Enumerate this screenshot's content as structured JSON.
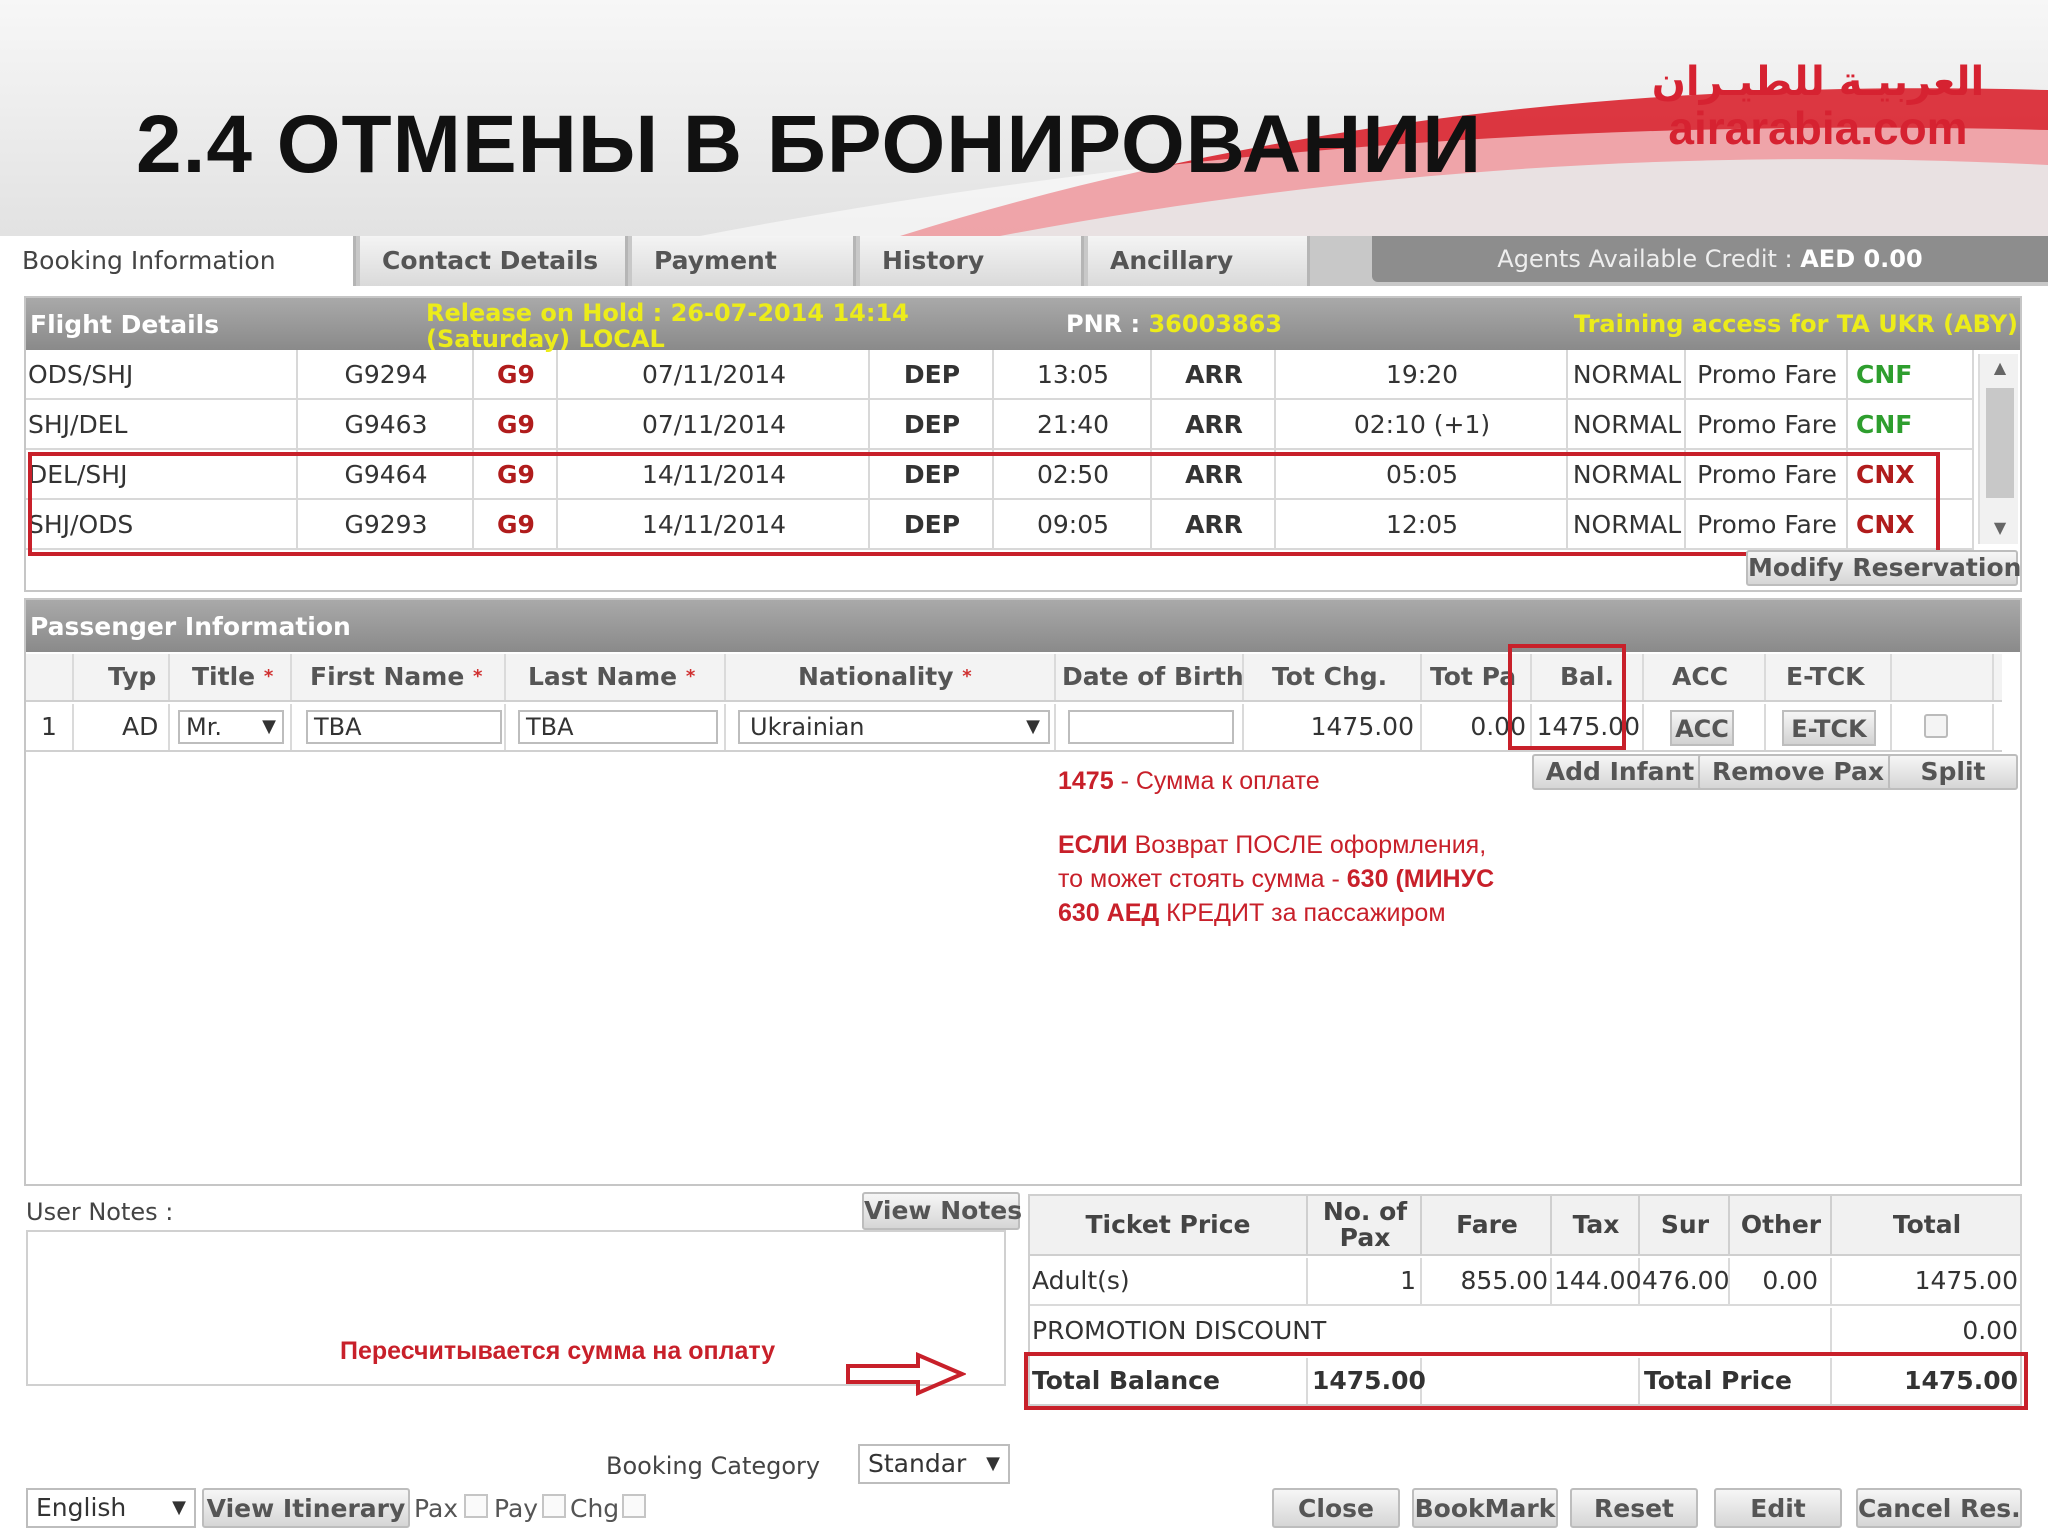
{
  "slide": {
    "title": "2.4 ОТМЕНЫ В БРОНИРОВАНИИ",
    "logo_arabic": "العربيـة للطيـران",
    "logo_latin": "airarabia.com"
  },
  "tabs": [
    "Booking Information",
    "Contact Details",
    "Payment",
    "History",
    "Ancillary"
  ],
  "credit": {
    "label": "Agents Available Credit : ",
    "value": "AED 0.00"
  },
  "flight": {
    "title": "Flight Details",
    "hold_line1": "Release on Hold : 26-07-2014 14:14",
    "hold_line2": "(Saturday) LOCAL",
    "pnr_label": "PNR : ",
    "pnr_value": "36003863",
    "training": "Training access for TA UKR (ABY)",
    "rows": [
      {
        "route": "ODS/SHJ",
        "flight": "G9294",
        "carrier": "G9",
        "date": "07/11/2014",
        "dep": "DEP",
        "dep_time": "13:05",
        "arr": "ARR",
        "arr_time": "19:20",
        "class": "NORMAL",
        "fare": "Promo Fare",
        "status": "CNF"
      },
      {
        "route": "SHJ/DEL",
        "flight": "G9463",
        "carrier": "G9",
        "date": "07/11/2014",
        "dep": "DEP",
        "dep_time": "21:40",
        "arr": "ARR",
        "arr_time": "02:10 (+1)",
        "class": "NORMAL",
        "fare": "Promo Fare",
        "status": "CNF"
      },
      {
        "route": "DEL/SHJ",
        "flight": "G9464",
        "carrier": "G9",
        "date": "14/11/2014",
        "dep": "DEP",
        "dep_time": "02:50",
        "arr": "ARR",
        "arr_time": "05:05",
        "class": "NORMAL",
        "fare": "Promo Fare",
        "status": "CNX"
      },
      {
        "route": "SHJ/ODS",
        "flight": "G9293",
        "carrier": "G9",
        "date": "14/11/2014",
        "dep": "DEP",
        "dep_time": "09:05",
        "arr": "ARR",
        "arr_time": "12:05",
        "class": "NORMAL",
        "fare": "Promo Fare",
        "status": "CNX"
      }
    ],
    "modify_btn": "Modify Reservation"
  },
  "passenger": {
    "title": "Passenger Information",
    "headers": {
      "type": "Typ",
      "title": "Title",
      "first": "First Name",
      "last": "Last Name",
      "nat": "Nationality",
      "dob": "Date of Birth",
      "tot_chg": "Tot Chg.",
      "tot_pay": "Tot Pa",
      "bal": "Bal.",
      "acc": "ACC",
      "etck": "E-TCK",
      "required_mark": "*"
    },
    "row": {
      "index": "1",
      "type": "AD",
      "title": "Mr.",
      "first": "TBA",
      "last": "TBA",
      "nat": "Ukrainian",
      "dob": "",
      "tot_chg": "1475.00",
      "tot_pay": "0.00",
      "bal": "1475.00",
      "acc": "ACC",
      "etck": "E-TCK"
    },
    "buttons": {
      "add_infant": "Add Infant",
      "remove_pax": "Remove Pax",
      "split": "Split"
    }
  },
  "annotations": {
    "amount_num": "1475",
    "amount_text": " - Сумма к оплате",
    "refund_l1_b": "ЕСЛИ",
    "refund_l1": " Возврат ПОСЛЕ оформления,",
    "refund_l2": "то может стоять сумма - ",
    "refund_l2_b": "630 (МИНУС",
    "refund_l3_b": "630 АЕД",
    "refund_l3": " КРЕДИТ за пассажиром",
    "recalc": "Пересчитывается сумма на оплату"
  },
  "notes": {
    "label": "User Notes :",
    "view_btn": "View Notes"
  },
  "pricing": {
    "headers": {
      "ticket": "Ticket Price",
      "pax": "No. of Pax",
      "fare": "Fare",
      "tax": "Tax",
      "sur": "Sur",
      "other": "Other",
      "total": "Total"
    },
    "adult": {
      "label": "Adult(s)",
      "pax": "1",
      "fare": "855.00",
      "tax": "144.00",
      "sur": "476.00",
      "other": "0.00",
      "total": "1475.00"
    },
    "promo": {
      "label": "PROMOTION DISCOUNT",
      "value": "0.00"
    },
    "summary": {
      "bal_label": "Total Balance",
      "bal_value": "1475.00",
      "price_label": "Total Price",
      "price_value": "1475.00"
    }
  },
  "footer": {
    "category_label": "Booking Category",
    "category_value": "Standar",
    "language": "English",
    "view_itinerary": "View Itinerary",
    "pax": "Pax",
    "pay": "Pay",
    "chg": "Chg",
    "buttons": {
      "close": "Close",
      "bookmark": "BookMark",
      "reset": "Reset",
      "edit": "Edit",
      "cancel": "Cancel Res."
    }
  },
  "colors": {
    "accent_red": "#c8202a",
    "status_green": "#2e9e2e",
    "hold_yellow": "#ecec1a",
    "panel_gray": "#8a8a8a"
  }
}
